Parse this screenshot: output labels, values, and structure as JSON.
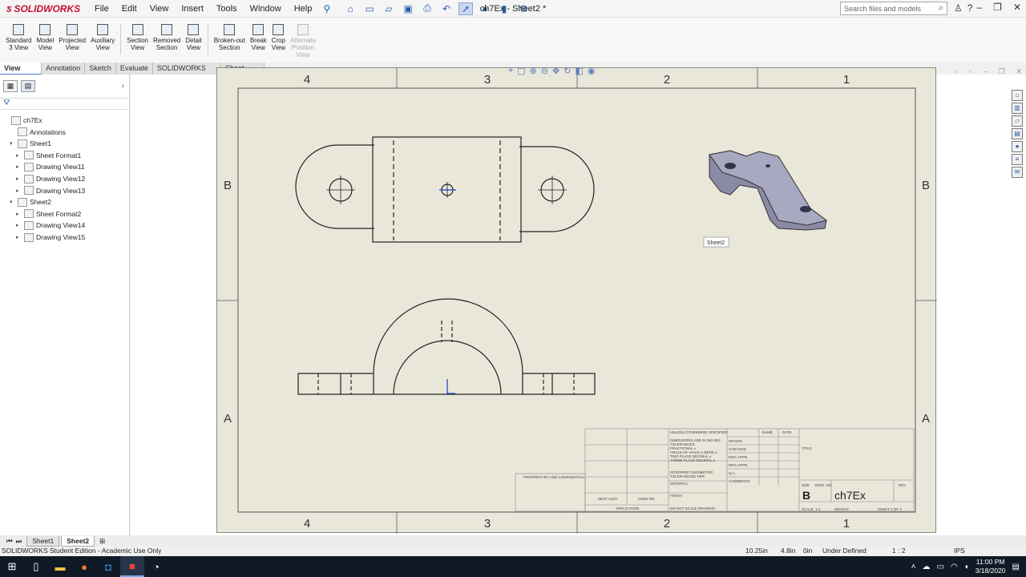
{
  "app": {
    "brand": "SOLIDWORKS",
    "document_title": "ch7Ex - Sheet2 *",
    "menu": [
      "File",
      "Edit",
      "View",
      "Insert",
      "Tools",
      "Window",
      "Help"
    ],
    "search_placeholder": "Search files and models"
  },
  "commands": [
    {
      "label": "Standard\n3 View",
      "icon": "standard-3-view-icon",
      "enabled": true
    },
    {
      "label": "Model\nView",
      "icon": "model-view-icon",
      "enabled": true
    },
    {
      "label": "Projected\nView",
      "icon": "projected-view-icon",
      "enabled": true
    },
    {
      "label": "Auxiliary\nView",
      "icon": "auxiliary-view-icon",
      "enabled": true
    },
    {
      "label": "Section\nView",
      "icon": "section-view-icon",
      "enabled": true
    },
    {
      "label": "Removed\nSection",
      "icon": "removed-section-icon",
      "enabled": true
    },
    {
      "label": "Detail\nView",
      "icon": "detail-view-icon",
      "enabled": true
    },
    {
      "label": "Broken-out\nSection",
      "icon": "broken-out-section-icon",
      "enabled": true
    },
    {
      "label": "Break\nView",
      "icon": "break-view-icon",
      "enabled": true
    },
    {
      "label": "Crop\nView",
      "icon": "crop-view-icon",
      "enabled": true
    },
    {
      "label": "Alternate\nPosition\nView",
      "icon": "alternate-position-view-icon",
      "enabled": false
    }
  ],
  "tabs": [
    "View Layout",
    "Annotation",
    "Sketch",
    "Evaluate",
    "SOLIDWORKS Add-Ins",
    "Sheet Format"
  ],
  "active_tab": "View Layout",
  "tree": [
    {
      "label": "ch7Ex",
      "level": 0,
      "toggle": "",
      "icon": "drawing-icon"
    },
    {
      "label": "Annotations",
      "level": 1,
      "toggle": "",
      "icon": "annotations-icon"
    },
    {
      "label": "Sheet1",
      "level": 1,
      "toggle": "▾",
      "icon": "sheet-icon"
    },
    {
      "label": "Sheet Format1",
      "level": 2,
      "toggle": "▸",
      "icon": "sheet-format-icon"
    },
    {
      "label": "Drawing View11",
      "level": 2,
      "toggle": "▸",
      "icon": "drawing-view-icon"
    },
    {
      "label": "Drawing View12",
      "level": 2,
      "toggle": "▸",
      "icon": "drawing-view-icon"
    },
    {
      "label": "Drawing View13",
      "level": 2,
      "toggle": "▸",
      "icon": "drawing-view-icon"
    },
    {
      "label": "Sheet2",
      "level": 1,
      "toggle": "▾",
      "icon": "sheet-icon"
    },
    {
      "label": "Sheet Format2",
      "level": 2,
      "toggle": "▸",
      "icon": "sheet-format-icon"
    },
    {
      "label": "Drawing View14",
      "level": 2,
      "toggle": "▸",
      "icon": "drawing-view-icon"
    },
    {
      "label": "Drawing View15",
      "level": 2,
      "toggle": "▸",
      "icon": "drawing-view-icon"
    }
  ],
  "sheet": {
    "zones_top": [
      "4",
      "3",
      "2",
      "1"
    ],
    "zones_side": [
      "B",
      "A"
    ],
    "tooltip": "Sheet2",
    "titleblock": {
      "unless": "UNLESS OTHERWISE SPECIFIED:",
      "name": "NAME",
      "date": "DATE",
      "drawn": "DRAWN",
      "checked": "CHECKED",
      "eng_appr": "ENG APPR.",
      "mfg_appr": "MFG APPR.",
      "qa": "Q.A.",
      "comments": "COMMENTS:",
      "title_label": "TITLE:",
      "size_label": "SIZE",
      "dwg_no_label": "DWG. NO.",
      "rev_label": "REV",
      "size": "B",
      "dwg_no": "ch7Ex",
      "scale": "SCALE: 1:2",
      "weight": "WEIGHT:",
      "sheet": "SHEET 2 OF 2",
      "proprietary": "PROPRIETARY AND CONFIDENTIAL",
      "dimensions": "DIMENSIONS ARE IN INCHES",
      "tolerances": "TOLERANCES:",
      "fractional": "FRACTIONAL ±",
      "angular": "ANGULAR: MACH ±  BEND ±",
      "two_place": "TWO PLACE DECIMAL  ±",
      "three_place": "THREE PLACE DECIMAL  ±",
      "interpret": "INTERPRET GEOMETRIC",
      "tolerancing": "TOLERANCING PER:",
      "material": "MATERIAL",
      "finish": "FINISH",
      "next_assy": "NEXT ASSY",
      "used_on": "USED ON",
      "application": "APPLICATION",
      "do_not_scale": "DO NOT SCALE DRAWING"
    }
  },
  "sheet_tabs": [
    "Sheet1",
    "Sheet2"
  ],
  "active_sheet": "Sheet2",
  "status": {
    "edition": "SOLIDWORKS Student Edition - Academic Use Only",
    "x": "10.25in",
    "y": "4.8in",
    "z": "0in",
    "state": "Under Defined",
    "scale": "1 : 2",
    "units": "IPS"
  },
  "clock": {
    "time": "11:00 PM",
    "date": "3/18/2020"
  },
  "colors": {
    "accent": "#c8102e",
    "sheet": "#e9e7da",
    "taskbar": "#0f1a26"
  }
}
